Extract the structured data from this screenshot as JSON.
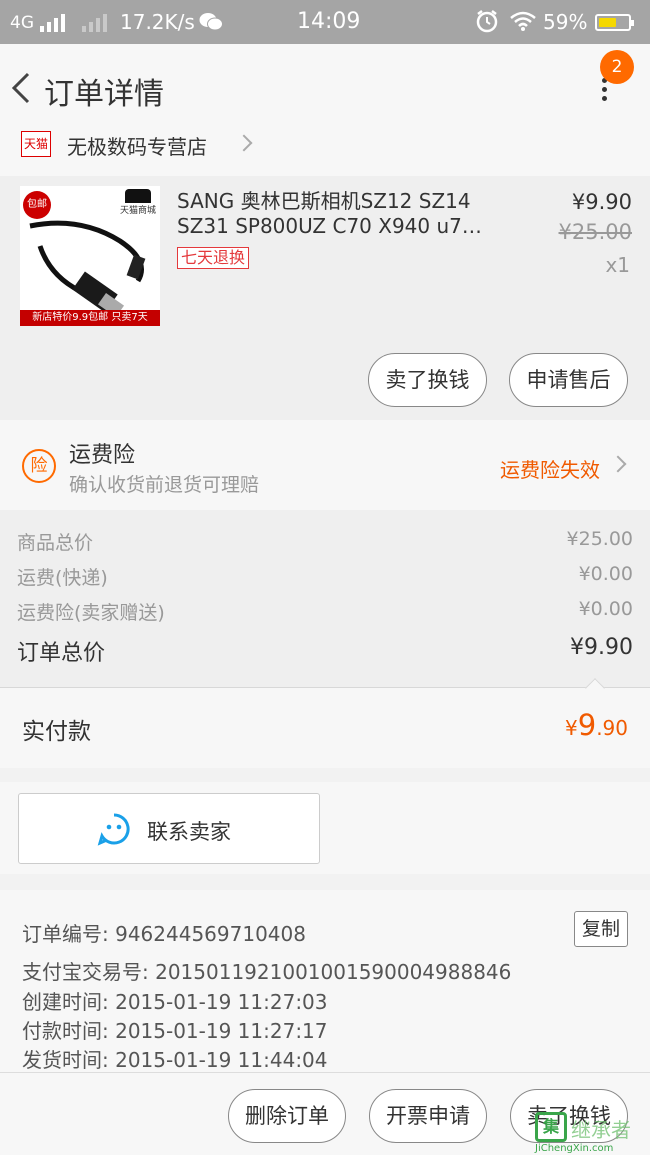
{
  "status_bar": {
    "network": "4G",
    "speed": "17.2K/s",
    "time": "14:09",
    "battery_pct": "59%",
    "battery_level": 0.59,
    "icons": [
      "signal-icon",
      "wechat-icon",
      "alarm-icon",
      "wifi-icon",
      "battery-icon"
    ]
  },
  "nav": {
    "title": "订单详情",
    "badge": "2"
  },
  "shop": {
    "badge": "天猫",
    "name": "无极数码专营店"
  },
  "item": {
    "thumb_badge": "包邮",
    "thumb_brand": "天猫商城",
    "thumb_strip": "新店特价9.9包邮 只卖7天",
    "title": "SANG 奥林巴斯相机SZ12 SZ14 SZ31 SP800UZ C70 X940 u7…",
    "tag": "七天退换",
    "price": "¥9.90",
    "original_price": "¥25.00",
    "qty": "x1",
    "actions": [
      "卖了换钱",
      "申请售后"
    ]
  },
  "insurance": {
    "icon": "险",
    "title": "运费险",
    "desc": "确认收货前退货可理赔",
    "status": "运费险失效"
  },
  "summary": [
    {
      "label": "商品总价",
      "value": "¥25.00"
    },
    {
      "label": "运费(快递)",
      "value": "¥0.00"
    },
    {
      "label": "运费险(卖家赠送)",
      "value": "¥0.00"
    },
    {
      "label": "订单总价",
      "value": "¥9.90"
    }
  ],
  "paid": {
    "label": "实付款",
    "currency": "¥",
    "int": "9",
    "dec": ".90"
  },
  "contact": {
    "label": "联系卖家"
  },
  "info": {
    "copy": "复制",
    "rows": [
      "订单编号: 946244569710408",
      "支付宝交易号: 2015011921001001590004988846",
      "创建时间: 2015-01-19 11:27:03",
      "付款时间: 2015-01-19 11:27:17",
      "发货时间: 2015-01-19 11:44:04"
    ]
  },
  "bottom_actions": [
    "删除订单",
    "开票申请",
    "卖了换钱"
  ],
  "watermark": {
    "glyph": "集",
    "cn": "继承者",
    "en": "JiChengXin.com"
  },
  "colors": {
    "accent": "#f05a00",
    "badge": "#ff6a00",
    "tmall_red": "#c40000",
    "contact_blue": "#1aa0e8"
  }
}
